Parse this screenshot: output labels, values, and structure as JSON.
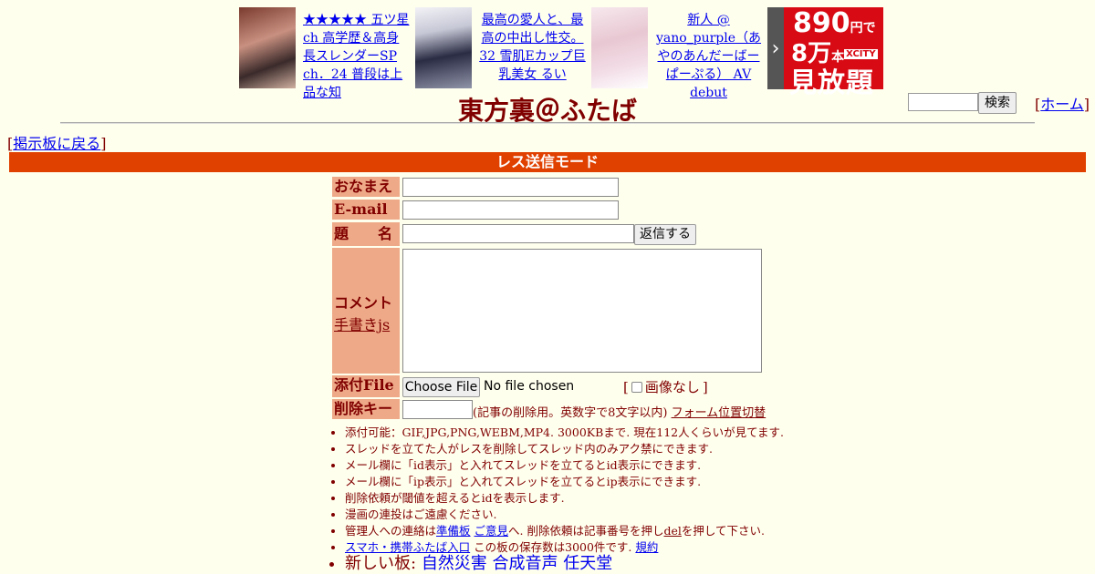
{
  "ads": [
    {
      "text": "★★★★★ 五ツ星ch 高学歴＆高身長スレンダーSP ch．24 普段は上品な知"
    },
    {
      "text": "最高の愛人と、最高の中出し性交。 32 雪肌Eカップ巨乳美女 るい"
    },
    {
      "text": "新人 @ yano_purple（あやのあんだーばーぱーぷる） AV debut"
    }
  ],
  "banner": {
    "price": "890",
    "price_unit": "円で",
    "count": "8万",
    "count_unit": "本",
    "brand": "XCITY",
    "label": "見放題"
  },
  "header": {
    "title": "東方裏＠ふたば",
    "search_button": "検索",
    "home_link": "ホーム",
    "back_link": "掲示板に戻る",
    "mode_label": "レス送信モード"
  },
  "form": {
    "name_label": "おなまえ",
    "email_label": "E-mail",
    "subject_label": "題　　名",
    "submit_button": "返信する",
    "comment_label": "コメント",
    "handwriting_link": "手書きjs",
    "file_label": "添付File",
    "file_button": "Choose File",
    "file_status": "No file chosen",
    "no_image_label": "画像なし",
    "delkey_label": "削除キー",
    "delkey_note": "(記事の削除用。英数字で8文字以内)",
    "form_switch_link": "フォーム位置切替"
  },
  "rules": {
    "r1": "添付可能：GIF,JPG,PNG,WEBM,MP4. 3000KBまで. 現在112人くらいが見てます.",
    "r2": "スレッドを立てた人がレスを削除してスレッド内のみアク禁にできます.",
    "r3": "メール欄に「id表示」と入れてスレッドを立てるとid表示にできます.",
    "r4": "メール欄に「ip表示」と入れてスレッドを立てるとip表示にできます.",
    "r5": "削除依頼が閾値を超えるとidを表示します.",
    "r6": "漫画の連投はご遠慮ください.",
    "r7_pre": "管理人への連絡は",
    "r7_link1": "準備板",
    "r7_link2": "ご意見",
    "r7_mid": "へ. 削除依頼は記事番号を押し",
    "r7_del": "del",
    "r7_post": "を押して下さい.",
    "r8_link": "スマホ・携帯ふたば入口",
    "r8_mid": "この板の保存数は3000件です.",
    "r8_link2": "規約",
    "r9_label": "新しい板:",
    "r9_b1": "自然災害",
    "r9_b2": "合成音声",
    "r9_b3": "任天堂"
  }
}
